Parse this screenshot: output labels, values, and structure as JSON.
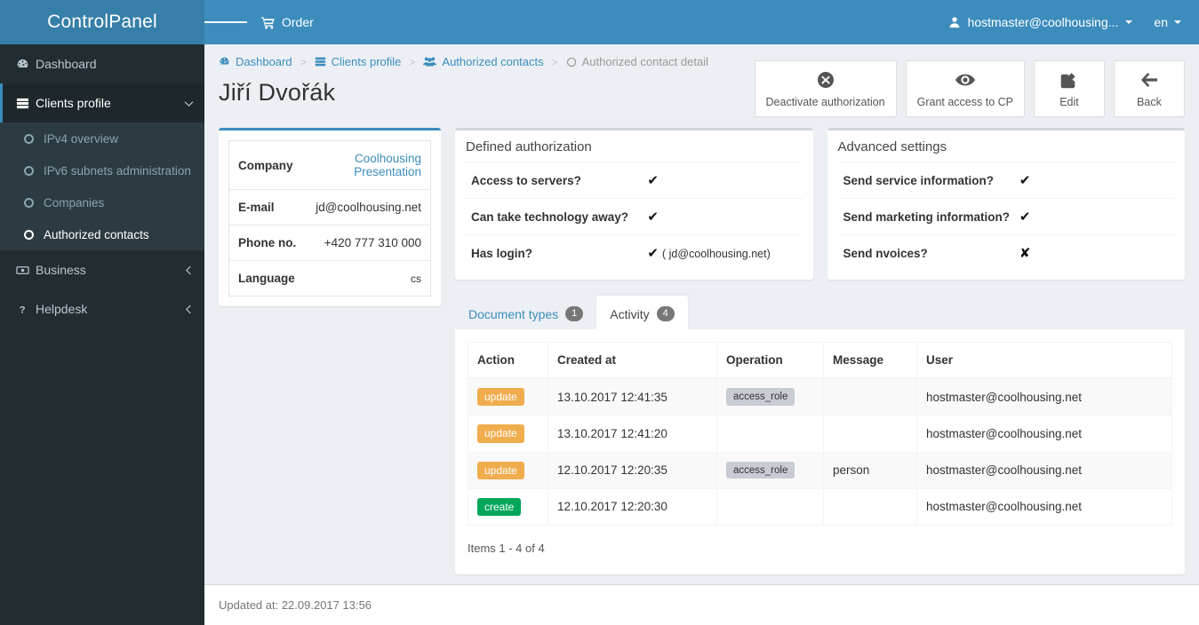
{
  "brand": {
    "title": "ControlPanel"
  },
  "topbar": {
    "menu_toggle": "menu-toggle",
    "order_label": "Order",
    "user_label": "hostmaster@coolhousing...",
    "lang_label": "en"
  },
  "sidebar": {
    "items": [
      {
        "label": "Dashboard",
        "icon": "dashboard-icon",
        "active": false,
        "arrow": ""
      },
      {
        "label": "Clients profile",
        "icon": "server-icon",
        "active": true,
        "arrow": "chevron-down"
      },
      {
        "label": "Business",
        "icon": "money-icon",
        "active": false,
        "arrow": "chevron-left"
      },
      {
        "label": "Helpdesk",
        "icon": "question-icon",
        "active": false,
        "arrow": "chevron-left"
      }
    ],
    "subitems": [
      {
        "label": "IPv4 overview",
        "active": false
      },
      {
        "label": "IPv6 subnets administration",
        "active": false
      },
      {
        "label": "Companies",
        "active": false
      },
      {
        "label": "Authorized contacts",
        "active": true
      }
    ]
  },
  "breadcrumb": [
    {
      "label": "Dashboard",
      "icon": "dashboard-icon"
    },
    {
      "label": "Clients profile",
      "icon": "server-icon"
    },
    {
      "label": "Authorized contacts",
      "icon": "users-icon"
    },
    {
      "label": "Authorized contact detail",
      "icon": "circle-icon"
    }
  ],
  "page": {
    "title": "Jiří Dvořák"
  },
  "actions": [
    {
      "label": "Deactivate authorization",
      "icon": "times-circle-icon"
    },
    {
      "label": "Grant access to CP",
      "icon": "eye-icon"
    },
    {
      "label": "Edit",
      "icon": "pencil-square-icon"
    },
    {
      "label": "Back",
      "icon": "arrow-left-icon"
    }
  ],
  "info_card": {
    "rows": [
      {
        "key": "Company",
        "value": "Coolhousing Presentation",
        "link": true
      },
      {
        "key": "E-mail",
        "value": "jd@coolhousing.net",
        "link": false
      },
      {
        "key": "Phone no.",
        "value": "+420 777 310 000",
        "link": false
      },
      {
        "key": "Language",
        "value": "cs",
        "link": false
      }
    ]
  },
  "defined_authorization": {
    "title": "Defined authorization",
    "rows": [
      {
        "question": "Access to servers?",
        "answer": "check",
        "note": ""
      },
      {
        "question": "Can take technology away?",
        "answer": "check",
        "note": ""
      },
      {
        "question": "Has login?",
        "answer": "check",
        "note": "( jd@coolhousing.net)"
      }
    ]
  },
  "advanced_settings": {
    "title": "Advanced settings",
    "rows": [
      {
        "question": "Send service information?",
        "answer": "check",
        "note": ""
      },
      {
        "question": "Send marketing information?",
        "answer": "check",
        "note": ""
      },
      {
        "question": "Send nvoices?",
        "answer": "cross",
        "note": ""
      }
    ]
  },
  "tabs": [
    {
      "label": "Document types",
      "badge": "1",
      "active": false
    },
    {
      "label": "Activity",
      "badge": "4",
      "active": true
    }
  ],
  "activity_table": {
    "columns": [
      "Action",
      "Created at",
      "Operation",
      "Message",
      "User"
    ],
    "rows": [
      {
        "action": "update",
        "action_color": "#f0ad4e",
        "created_at": "13.10.2017 12:41:35",
        "operation": "access_role",
        "message": "",
        "user": "hostmaster@coolhousing.net"
      },
      {
        "action": "update",
        "action_color": "#f0ad4e",
        "created_at": "13.10.2017 12:41:20",
        "operation": "",
        "message": "",
        "user": "hostmaster@coolhousing.net"
      },
      {
        "action": "update",
        "action_color": "#f0ad4e",
        "created_at": "12.10.2017 12:20:35",
        "operation": "access_role",
        "message": "person",
        "user": "hostmaster@coolhousing.net"
      },
      {
        "action": "create",
        "action_color": "#00a65a",
        "created_at": "12.10.2017 12:20:30",
        "operation": "",
        "message": "",
        "user": "hostmaster@coolhousing.net"
      }
    ],
    "items_count": "Items 1 - 4 of 4"
  },
  "footer": {
    "updated_at": "Updated at: 22.09.2017 13:56"
  },
  "colors": {
    "brand": "#3c8dbc",
    "brand_dark": "#367fa9",
    "sidebar": "#222d32",
    "sidebar_sub": "#2c3b41",
    "content_bg": "#ecf0f5",
    "warning": "#f0ad4e",
    "success": "#00a65a"
  }
}
